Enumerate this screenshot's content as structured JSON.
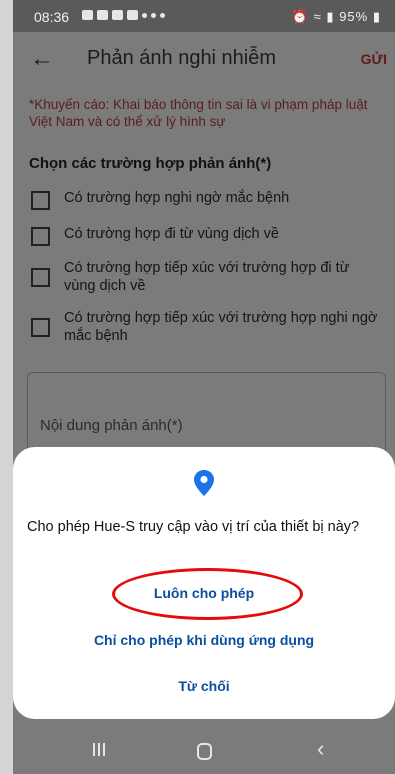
{
  "status_bar": {
    "time": "08:36",
    "system": "95%"
  },
  "header": {
    "title": "Phản ánh nghi nhiễm",
    "send_label": "GỬI"
  },
  "warning": "*Khuyến cáo: Khai báo thông tin sai là vi phạm pháp luật Việt Nam và có thể xử lý hình sự",
  "section_title": "Chọn các trường hợp phản ánh(*)",
  "options": [
    {
      "label": "Có trường hợp nghi ngờ mắc bệnh"
    },
    {
      "label": "Có trường hợp đi từ vùng dịch về"
    },
    {
      "label": "Có trường hợp tiếp xúc với trường hợp đi từ vùng dịch về"
    },
    {
      "label": "Có trường hợp tiếp xúc với trường hợp nghi ngờ mắc bệnh"
    }
  ],
  "content_field": {
    "placeholder": "Nội dung phản ánh(*)"
  },
  "permission_dialog": {
    "icon": "location-pin-icon",
    "message": "Cho phép Hue-S truy cập vào vị trí của thiết bị này?",
    "allow_always": "Luôn cho phép",
    "allow_while_using": "Chỉ cho phép khi dùng ứng dụng",
    "deny": "Từ chối",
    "accent_color": "#1a73e8",
    "highlight_color": "#e30b0b"
  }
}
